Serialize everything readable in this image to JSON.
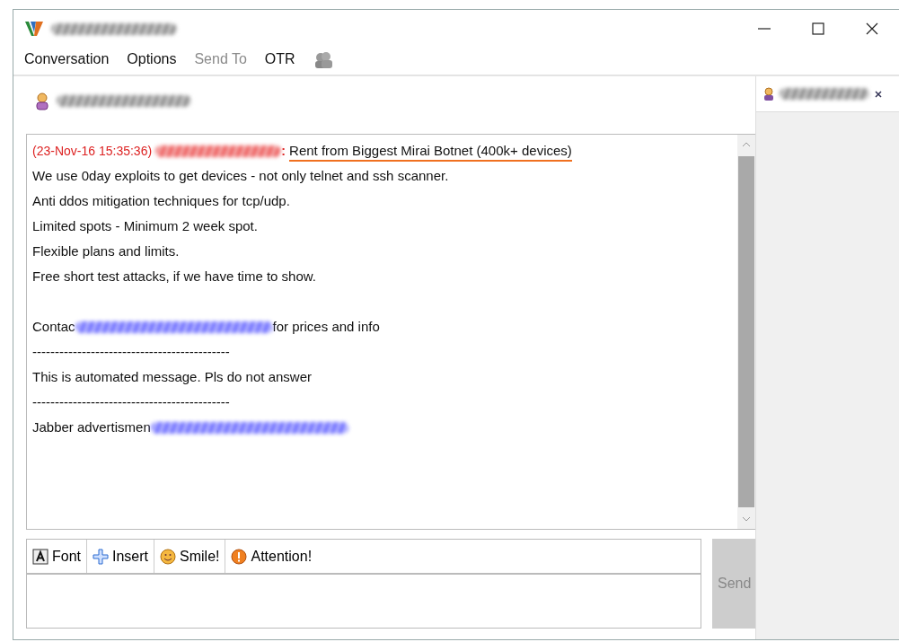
{
  "window": {
    "controls": [
      {
        "kind": "minimize"
      },
      {
        "kind": "maximize"
      },
      {
        "kind": "close"
      }
    ]
  },
  "menu": [
    {
      "label": "Conversation",
      "disabled": false,
      "kind": "text"
    },
    {
      "label": "Options",
      "disabled": false,
      "kind": "text"
    },
    {
      "label": "Send To",
      "disabled": true,
      "kind": "text"
    },
    {
      "label": "OTR",
      "disabled": false,
      "kind": "text"
    },
    {
      "kind": "icon",
      "disabled": false
    }
  ],
  "message": {
    "timestamp": "(23-Nov-16 15:35:36)",
    "separator": ":",
    "subject": "Rent from Biggest Mirai Botnet (400k+ devices)",
    "lines": [
      {
        "kind": "text",
        "segments": [
          {
            "kind": "text",
            "text": "We use 0day exploits to get devices - not only telnet and ssh scanner."
          }
        ]
      },
      {
        "kind": "text",
        "segments": [
          {
            "kind": "text",
            "text": "Anti ddos mitigation techniques for tcp/udp."
          }
        ]
      },
      {
        "kind": "text",
        "segments": [
          {
            "kind": "text",
            "text": "Limited spots - Minimum 2 week spot."
          }
        ]
      },
      {
        "kind": "text",
        "segments": [
          {
            "kind": "text",
            "text": "Flexible plans and limits."
          }
        ]
      },
      {
        "kind": "text",
        "segments": [
          {
            "kind": "text",
            "text": "Free short test attacks, if we have time to show."
          }
        ]
      },
      {
        "kind": "blank"
      },
      {
        "kind": "text",
        "segments": [
          {
            "kind": "text",
            "text": "Contac"
          },
          {
            "kind": "redacted"
          },
          {
            "kind": "text",
            "text": "for prices and info"
          }
        ]
      },
      {
        "kind": "text",
        "segments": [
          {
            "kind": "text",
            "text": "--------------------------------------------"
          }
        ]
      },
      {
        "kind": "text",
        "segments": [
          {
            "kind": "text",
            "text": "This is automated message. Pls do not answer"
          }
        ]
      },
      {
        "kind": "text",
        "segments": [
          {
            "kind": "text",
            "text": "--------------------------------------------"
          }
        ]
      },
      {
        "kind": "text",
        "segments": [
          {
            "kind": "text",
            "text": "Jabber advertismen"
          },
          {
            "kind": "redacted"
          }
        ]
      }
    ]
  },
  "toolbar": [
    {
      "kind": "font",
      "label": "Font"
    },
    {
      "kind": "insert",
      "label": "Insert"
    },
    {
      "kind": "smile",
      "label": "Smile!"
    },
    {
      "kind": "attention",
      "label": "Attention!"
    }
  ],
  "send_button": {
    "label": "Send",
    "disabled": true
  },
  "tabs": [
    {
      "selected": true
    }
  ]
}
